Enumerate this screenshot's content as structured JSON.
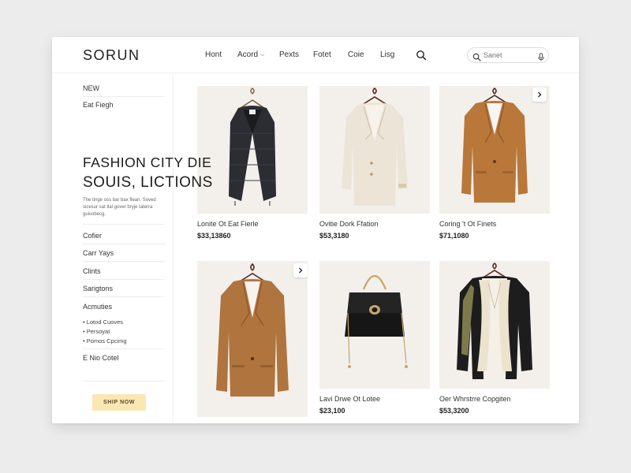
{
  "header": {
    "logo": "SORUN",
    "nav": [
      {
        "label": "Hont"
      },
      {
        "label": "Acord"
      },
      {
        "label": "Pexts"
      },
      {
        "label": "Fotet"
      },
      {
        "label": "Coie"
      },
      {
        "label": "Lisg"
      }
    ],
    "search": {
      "placeholder": "Sanet"
    }
  },
  "sidebar": {
    "new_label": "NEW",
    "item_fiegh": "Eat Fiegh",
    "hero_line1": "FASHION CITY DIE",
    "hero_line2": "SOUIS, LICTIONS",
    "hero_desc": "The tinge oss bar bax flean. Soved sicesur sat tlal gover bryje taterra guisobecg.",
    "links": [
      "Cofier",
      "Carr Yays",
      "Clints",
      "Sarigtons"
    ],
    "section_title": "Acmuties",
    "bullets": [
      "Lotod Cuoves",
      "Persoyat",
      "Pomos Cpcimg"
    ],
    "footer_item": "E Nio Cotel",
    "cta_label": "SHIP NOW"
  },
  "products": [
    {
      "name": "Lonite Ot Eat Fierle",
      "price": "$33,13860",
      "image": "black-tweed-vest"
    },
    {
      "name": "Ovitie Dork Ffation",
      "price": "$53,3180",
      "image": "cream-blazer"
    },
    {
      "name": "Coring 't Ot Finets",
      "price": "$71,1080",
      "image": "camel-blazer"
    },
    {
      "name": "",
      "price": "",
      "image": "tan-blazer"
    },
    {
      "name": "Lavi Drwe Ot Lotee",
      "price": "$23,100",
      "image": "black-handbag"
    },
    {
      "name": "Oer Whrstrre Copgiten",
      "price": "$53,3200",
      "image": "scarf-outfit"
    }
  ],
  "colors": {
    "cta_bg": "#fbe7b4",
    "card_bg": "#f3f0ec",
    "page_bg": "#ececec"
  }
}
